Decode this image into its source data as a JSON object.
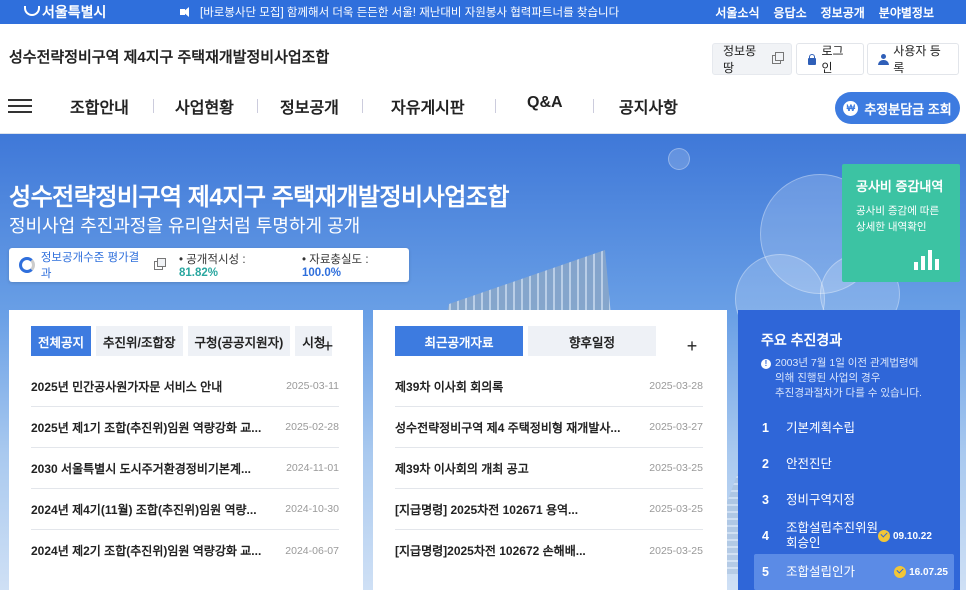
{
  "topbar": {
    "logo": "서울특별시",
    "notice": "[바로봉사단 모집] 함께해서 더욱 든든한 서울! 재난대비 자원봉사 협력파트너를 찾습니다",
    "links": [
      "서울소식",
      "응답소",
      "정보공개",
      "분야별정보"
    ]
  },
  "header": {
    "site_title": "성수전략정비구역 제4지구 주택재개발정비사업조합",
    "info_button": "정보몽땅",
    "login_button": "로그인",
    "register_button": "사용자 등록",
    "nav": [
      "조합안내",
      "사업현황",
      "정보공개",
      "자유게시판",
      "Q&A",
      "공지사항"
    ],
    "estimate_button": "추정분담금 조회",
    "won_icon": "₩"
  },
  "hero": {
    "title": "성수전략정비구역 제4지구 주택재개발정비사업조합",
    "subtitle": "정비사업 추진과정을 유리알처럼 투명하게 공개",
    "eval_label": "정보공개수준 평가결과",
    "timeliness_label": "공개적시성 : ",
    "timeliness_value": "81.82%",
    "fidelity_label": "자료충실도 : ",
    "fidelity_value": "100.0%"
  },
  "cost_card": {
    "title": "공사비 증감내역",
    "desc_1": "공사비 증감에 따른",
    "desc_2": "상세한 내역확인"
  },
  "notice_panel": {
    "tabs": [
      "전체공지",
      "추진위/조합장",
      "구청(공공지원자)",
      "시청"
    ],
    "rows": [
      {
        "title": "2025년 민간공사원가자문 서비스 안내",
        "date": "2025-03-11"
      },
      {
        "title": "2025년 제1기 조합(추진위)임원 역량강화 교...",
        "date": "2025-02-28"
      },
      {
        "title": "2030 서울특별시 도시주거환경정비기본계...",
        "date": "2024-11-01"
      },
      {
        "title": "2024년 제4기(11월) 조합(추진위)임원 역량...",
        "date": "2024-10-30"
      },
      {
        "title": "2024년 제2기 조합(추진위)임원 역량강화 교...",
        "date": "2024-06-07"
      }
    ]
  },
  "data_panel": {
    "tabs": [
      "최근공개자료",
      "향후일정"
    ],
    "rows": [
      {
        "title": "제39차 이사회 회의록",
        "date": "2025-03-28"
      },
      {
        "title": "성수전략정비구역 제4 주택정비형 재개발사...",
        "date": "2025-03-27"
      },
      {
        "title": "제39차 이사회의 개최 공고",
        "date": "2025-03-25"
      },
      {
        "title": "[지급명령] 2025차전 102671 용역...",
        "date": "2025-03-25"
      },
      {
        "title": "[지급명령]2025차전 102672 손해배...",
        "date": "2025-03-25"
      }
    ]
  },
  "progress": {
    "title": "주요 추진경과",
    "note_1": "2003년 7월 1일 이전 관계법령에",
    "note_2": "의해 진행된 사업의 경우",
    "note_3": "추진경과절차가 다를 수 있습니다.",
    "steps": [
      {
        "num": "1",
        "label": "기본계획수립",
        "date": ""
      },
      {
        "num": "2",
        "label": "안전진단",
        "date": ""
      },
      {
        "num": "3",
        "label": "정비구역지정",
        "date": ""
      },
      {
        "num": "4",
        "label": "조합설립추진위원회승인",
        "date": "09.10.22"
      },
      {
        "num": "5",
        "label": "조합설립인가",
        "date": "16.07.25"
      }
    ]
  },
  "plus_label": "+",
  "colors": {
    "primary": "#2f6fdc",
    "accent_green": "#3cc3a3",
    "progress_bg": "#2f66d8"
  }
}
